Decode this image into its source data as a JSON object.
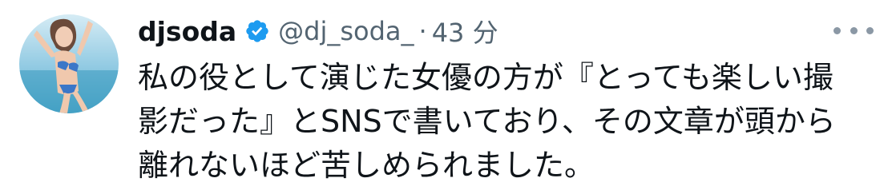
{
  "tweet": {
    "display_name": "djsoda",
    "handle": "@dj_soda_",
    "separator": "·",
    "time": "43 分",
    "lines": [
      "私の役として演じた女優の方が『とっても楽しい撮",
      "影だった』とSNSで書いており、その文章が頭から",
      "離れないほど苦しめられました。"
    ]
  },
  "icons": {
    "verified": "verified-badge-icon",
    "more": "more-options-icon",
    "avatar": "profile-avatar"
  },
  "colors": {
    "verified": "#1d9bf0",
    "text": "#0f1419",
    "secondary": "#536471",
    "more_dots": "#8b98a5"
  }
}
